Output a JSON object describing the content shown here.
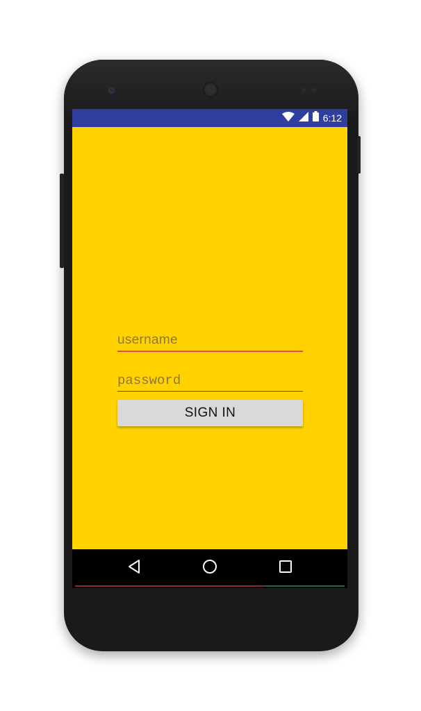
{
  "status_bar": {
    "time": "6:12",
    "icons": [
      "wifi-icon",
      "cell-signal-icon",
      "battery-icon"
    ],
    "color": "#303f9f"
  },
  "app": {
    "background_color": "#ffd200",
    "username": {
      "placeholder": "username",
      "value": ""
    },
    "password": {
      "placeholder": "password",
      "value": ""
    },
    "sign_in_label": "SIGN IN"
  },
  "nav_bar": {
    "buttons": [
      "back-icon",
      "home-icon",
      "recents-icon"
    ]
  },
  "colors": {
    "active_underline": "#e8454f",
    "button_bg": "#d9d9d9"
  }
}
